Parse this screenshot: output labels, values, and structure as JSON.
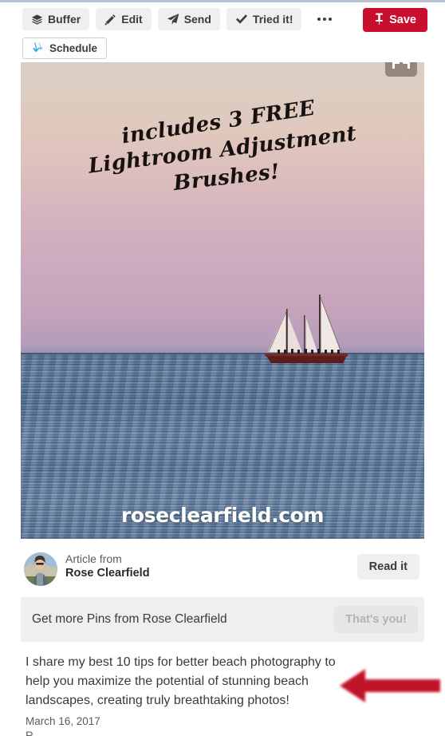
{
  "top_rule_color": "#b8c4d4",
  "toolbar": {
    "buttons": [
      {
        "label": "Buffer",
        "icon": "layers-icon"
      },
      {
        "label": "Edit",
        "icon": "pencil-icon"
      },
      {
        "label": "Send",
        "icon": "paper-plane-icon"
      },
      {
        "label": "Tried it!",
        "icon": "check-icon"
      }
    ],
    "more_label": "…",
    "save_label": "Save",
    "save_icon": "pin-icon",
    "save_color": "#c8102e",
    "schedule_label": "Schedule",
    "schedule_icon": "buffer-schedule-icon"
  },
  "pin_image": {
    "overlay_line1": "includes 3 FREE",
    "overlay_line2": "Lightroom Adjustment",
    "overlay_line3": "Brushes!",
    "watermark": "roseclearfield.com",
    "expand_icon": "expand-arrows-icon",
    "subject": "schooner-sailboat-on-ocean-at-sunset"
  },
  "article": {
    "from_label": "Article from",
    "author": "Rose Clearfield",
    "avatar_icon": "user-avatar",
    "read_button": "Read it"
  },
  "follow_banner": {
    "text": "Get more Pins from Rose Clearfield",
    "button_label": "That's you!"
  },
  "pin": {
    "description": "I share my best 10 tips for better beach photography to help you maximize the potential of stunning beach landscapes, creating truly breathtaking photos!",
    "date": "March 16, 2017",
    "cut_off_text": "R"
  },
  "annotation": {
    "type": "red-left-arrow",
    "color": "#c0142b"
  }
}
